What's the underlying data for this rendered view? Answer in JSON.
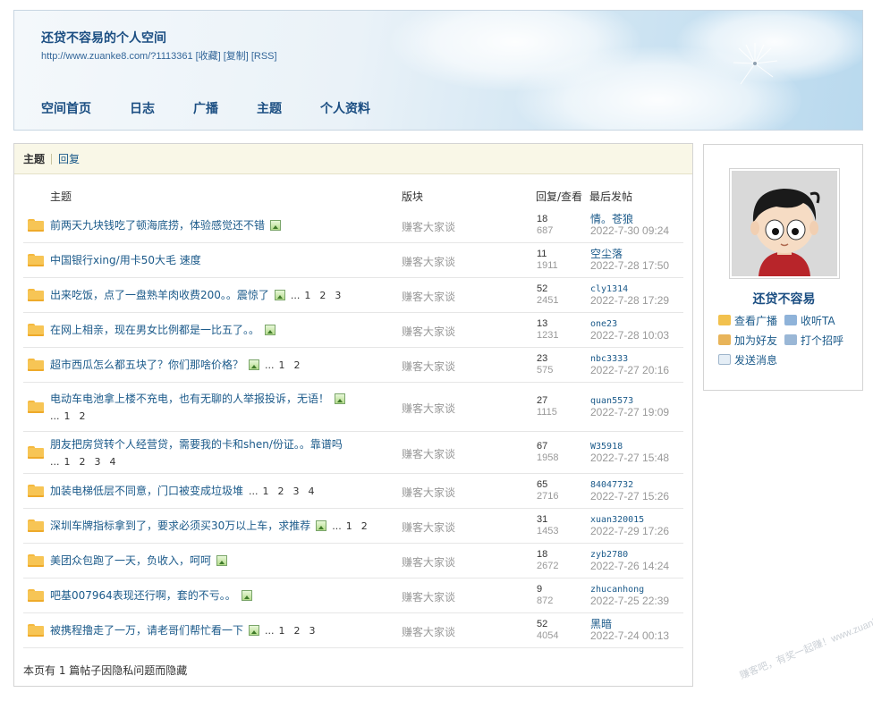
{
  "header": {
    "title": "还贷不容易的个人空间",
    "url": "http://www.zuanke8.com/?1113361",
    "links": [
      "[收藏]",
      "[复制]",
      "[RSS]"
    ],
    "nav": [
      "空间首页",
      "日志",
      "广播",
      "主题",
      "个人资料"
    ]
  },
  "tabs": {
    "active": "主题",
    "other": "回复"
  },
  "table": {
    "headers": {
      "subject": "主题",
      "forum": "版块",
      "replies": "回复/查看",
      "last": "最后发帖"
    },
    "rows": [
      {
        "subject": "前两天九块钱吃了顿海底捞，体验感觉还不错",
        "image": true,
        "pages": [],
        "forum": "赚客大家谈",
        "replies": "18",
        "views": "687",
        "user": "情。苍狼",
        "date": "2022-7-30 09:24"
      },
      {
        "subject": "中国银行xing/用卡50大毛 速度",
        "image": false,
        "pages": [],
        "forum": "赚客大家谈",
        "replies": "11",
        "views": "1911",
        "user": "空尘落",
        "date": "2022-7-28 17:50"
      },
      {
        "subject": "出来吃饭，点了一盘熟羊肉收费200。。震惊了",
        "image": true,
        "pages": [
          "1",
          "2",
          "3"
        ],
        "forum": "赚客大家谈",
        "replies": "52",
        "views": "2451",
        "user": "cly1314",
        "date": "2022-7-28 17:29"
      },
      {
        "subject": "在网上相亲，现在男女比例都是一比五了。。",
        "image": true,
        "pages": [],
        "forum": "赚客大家谈",
        "replies": "13",
        "views": "1231",
        "user": "one23",
        "date": "2022-7-28 10:03"
      },
      {
        "subject": "超市西瓜怎么都五块了？你们那啥价格？",
        "image": true,
        "pages": [
          "1",
          "2"
        ],
        "forum": "赚客大家谈",
        "replies": "23",
        "views": "575",
        "user": "nbc3333",
        "date": "2022-7-27 20:16"
      },
      {
        "subject": "电动车电池拿上楼不充电，也有无聊的人举报投诉，无语！",
        "image": true,
        "pages": [
          "1",
          "2"
        ],
        "forum": "赚客大家谈",
        "replies": "27",
        "views": "1115",
        "user": "quan5573",
        "date": "2022-7-27 19:09"
      },
      {
        "subject": "朋友把房贷转个人经营贷，需要我的卡和shen/份证。。靠谱吗",
        "image": false,
        "pages": [
          "1",
          "2",
          "3",
          "4"
        ],
        "forum": "赚客大家谈",
        "replies": "67",
        "views": "1958",
        "user": "W35918",
        "date": "2022-7-27 15:48"
      },
      {
        "subject": "加装电梯低层不同意，门口被变成垃圾堆",
        "image": false,
        "pages": [
          "1",
          "2",
          "3",
          "4"
        ],
        "forum": "赚客大家谈",
        "replies": "65",
        "views": "2716",
        "user": "84047732",
        "date": "2022-7-27 15:26"
      },
      {
        "subject": "深圳车牌指标拿到了，要求必须买30万以上车，求推荐",
        "image": true,
        "pages": [
          "1",
          "2"
        ],
        "forum": "赚客大家谈",
        "replies": "31",
        "views": "1453",
        "user": "xuan320015",
        "date": "2022-7-29 17:26"
      },
      {
        "subject": "美团众包跑了一天，负收入，呵呵",
        "image": true,
        "pages": [],
        "forum": "赚客大家谈",
        "replies": "18",
        "views": "2672",
        "user": "zyb2780",
        "date": "2022-7-26 14:24"
      },
      {
        "subject": "吧基007964表现还行啊，套的不亏。。",
        "image": true,
        "pages": [],
        "forum": "赚客大家谈",
        "replies": "9",
        "views": "872",
        "user": "zhucanhong",
        "date": "2022-7-25 22:39"
      },
      {
        "subject": "被携程撸走了一万，请老哥们帮忙看一下",
        "image": true,
        "pages": [
          "1",
          "2",
          "3"
        ],
        "forum": "赚客大家谈",
        "replies": "52",
        "views": "4054",
        "user": "黑暗",
        "date": "2022-7-24 00:13"
      }
    ],
    "ellipsis": "...",
    "footnote": "本页有 1 篇帖子因隐私问题而隐藏"
  },
  "sidebar": {
    "name": "还贷不容易",
    "actions": [
      "查看广播",
      "收听TA",
      "加为好友",
      "打个招呼",
      "发送消息"
    ]
  },
  "watermark": "赚客吧，有奖一起赚！www.zuanke8.com"
}
